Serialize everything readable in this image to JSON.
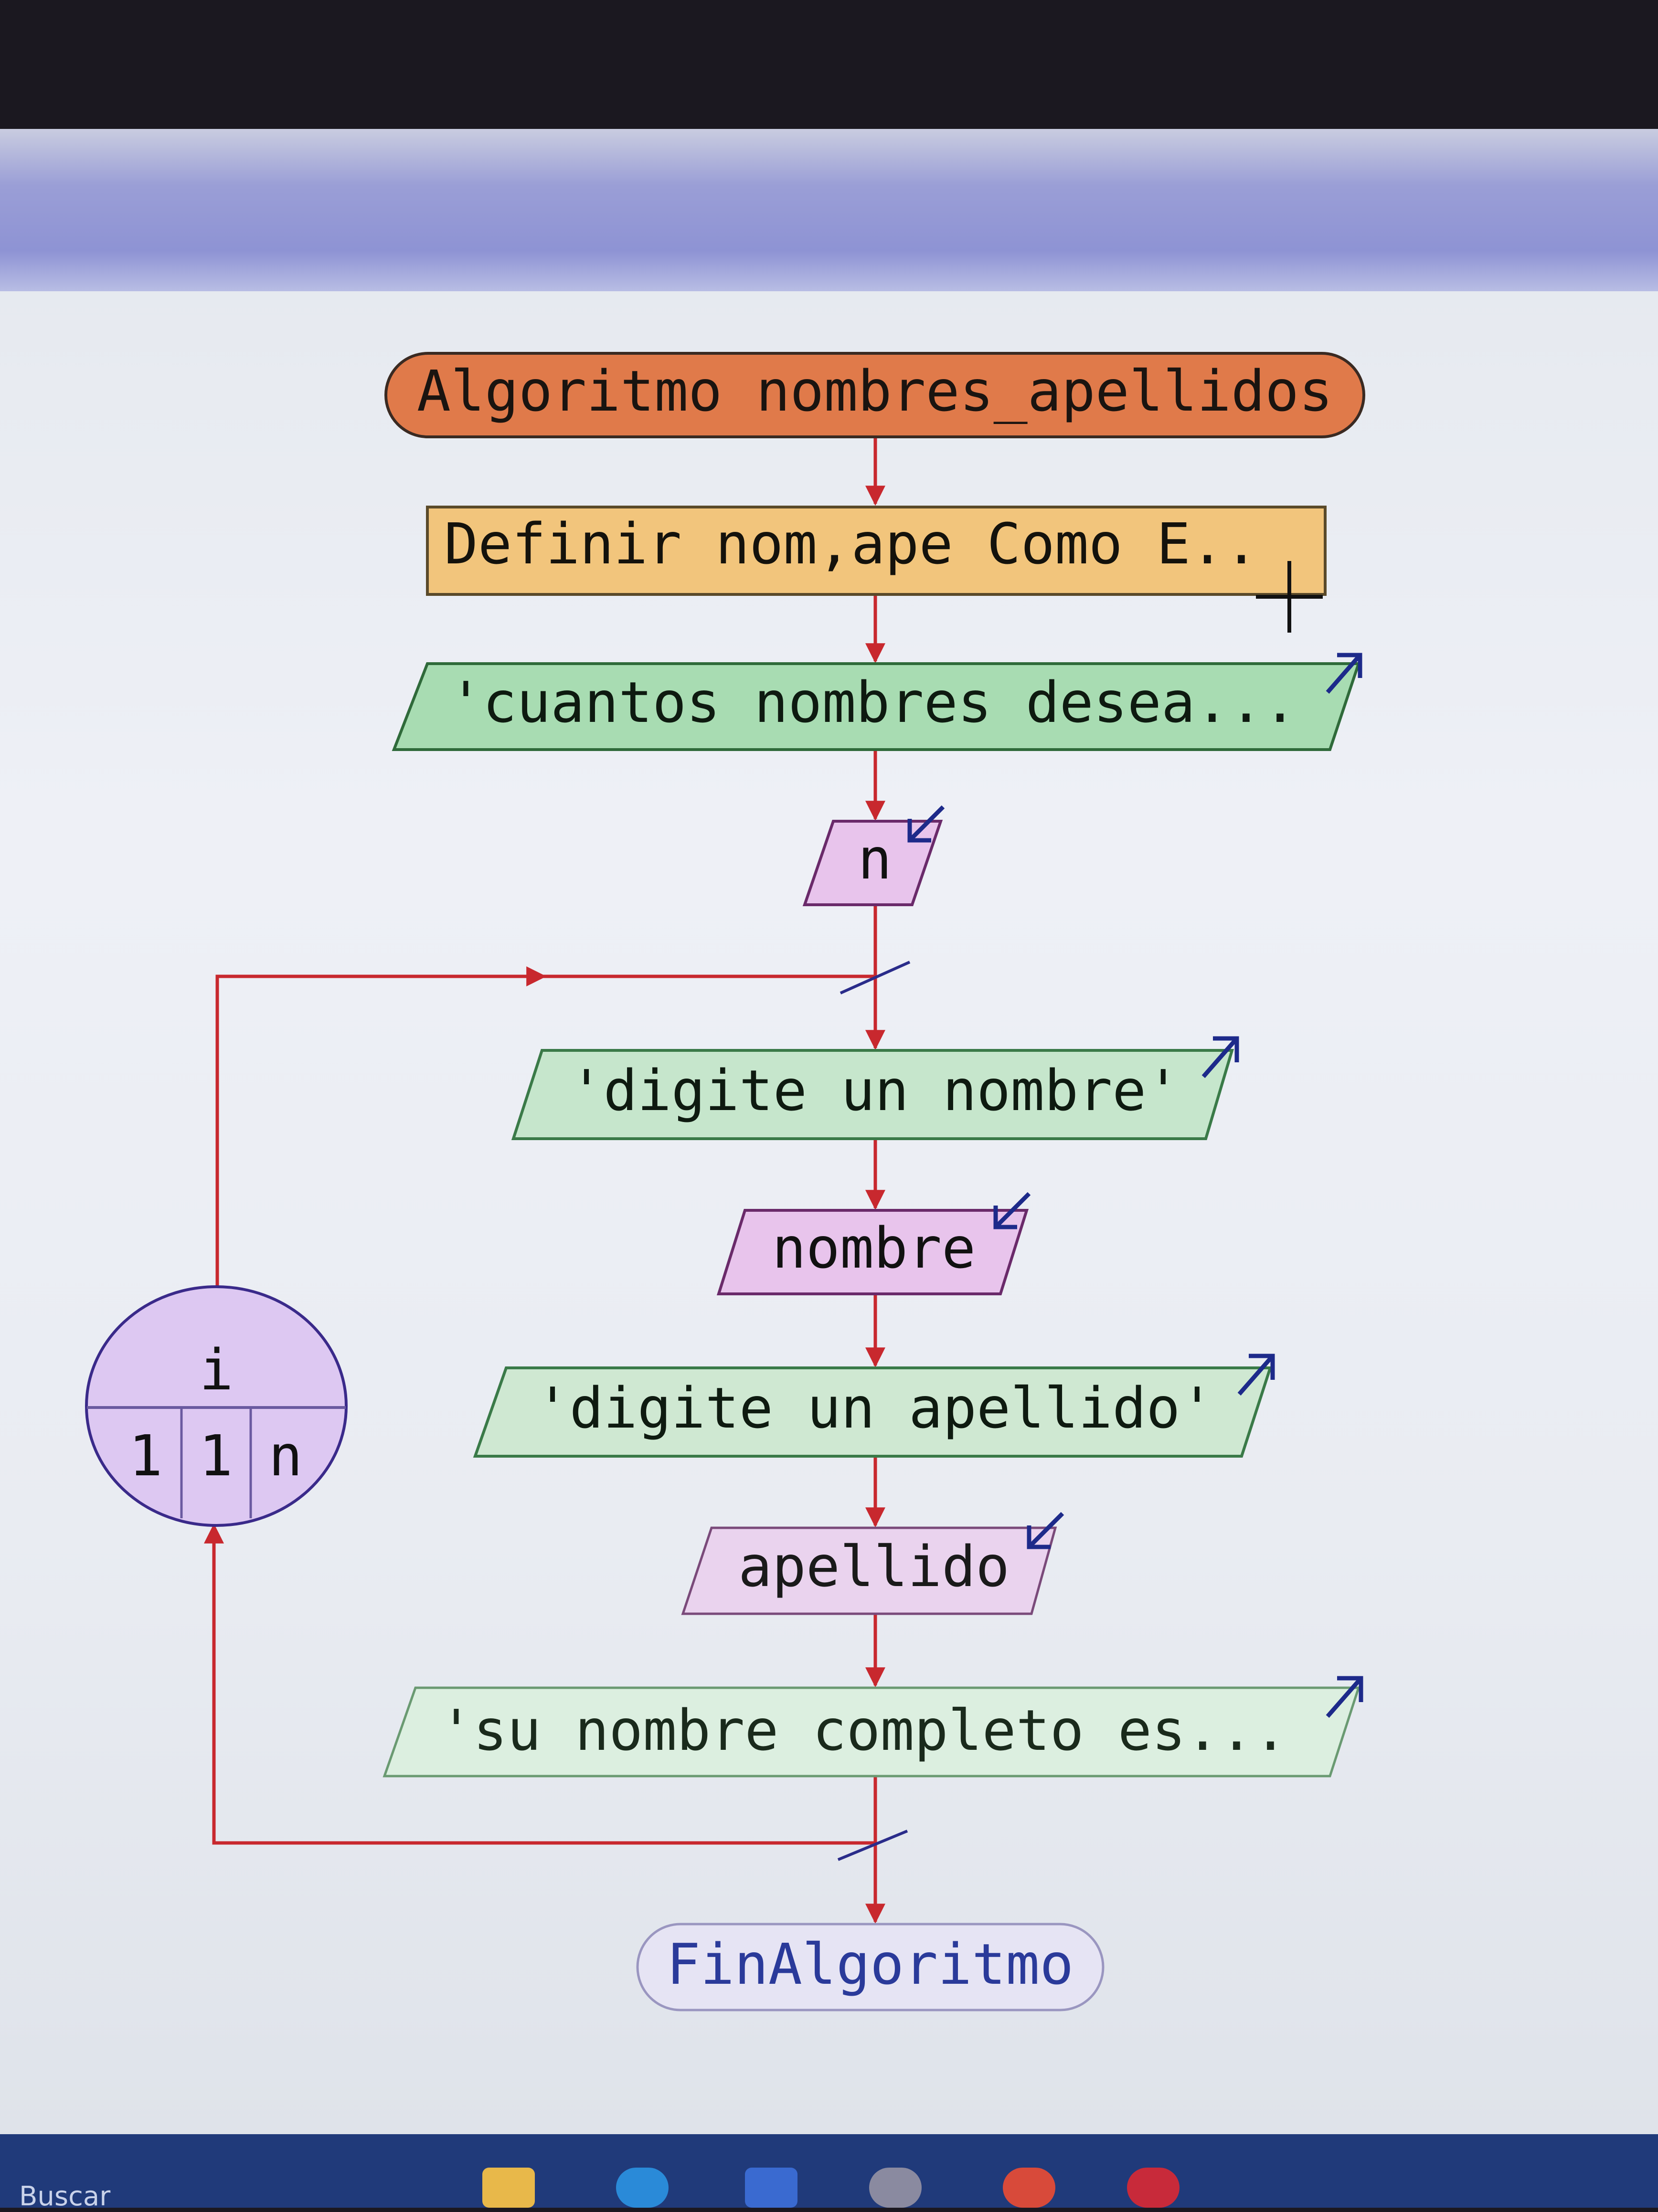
{
  "diagram": {
    "start_label": "Algoritmo nombres_apellidos",
    "define_label": "Definir nom,ape Como E..",
    "output1_label": "'cuantos nombres desea...",
    "input_n_label": "n",
    "output2_label": "'digite un nombre'",
    "input_nombre_label": "nombre",
    "output3_label": "'digite un apellido'",
    "input_apellido_label": "apellido",
    "output4_label": "'su nombre completo es...",
    "end_label": "FinAlgoritmo",
    "loop": {
      "variable": "i",
      "start": "1",
      "step": "1",
      "end": "n"
    }
  },
  "taskbar": {
    "search_label": "Buscar"
  },
  "colors": {
    "arrow": "#c8282e",
    "start_fill": "#e07a4a",
    "define_fill": "#f2c57c",
    "output_fill": "#a8dcb2",
    "input_fill": "#e8c4ec",
    "loop_fill": "#ddc8f2",
    "io_arrow": "#1d2a8a"
  }
}
